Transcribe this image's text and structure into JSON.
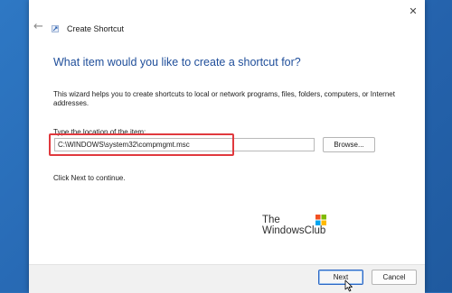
{
  "window": {
    "title": "Create Shortcut",
    "back_glyph": "←",
    "close_glyph": "✕"
  },
  "wizard": {
    "heading": "What item would you like to create a shortcut for?",
    "description": "This wizard helps you to create shortcuts to local or network programs, files, folders, computers, or Internet addresses.",
    "location_label": "Type the location of the item:",
    "location_value": "C:\\WINDOWS\\system32\\compmgmt.msc",
    "browse_label": "Browse...",
    "hint": "Click Next to continue."
  },
  "footer": {
    "next_label": "Next",
    "cancel_label": "Cancel"
  },
  "watermark": {
    "line1": "The",
    "line2": "WindowsClub"
  },
  "colors": {
    "heading": "#1f4e9a",
    "highlight": "#e0393e",
    "background": "#2b6fb8",
    "default_button_border": "#2b66c4"
  },
  "icons": {
    "back": "back-arrow-icon",
    "app": "shortcut-app-icon",
    "close": "close-icon",
    "logo": "windows-logo-icon",
    "cursor": "mouse-cursor-icon"
  }
}
